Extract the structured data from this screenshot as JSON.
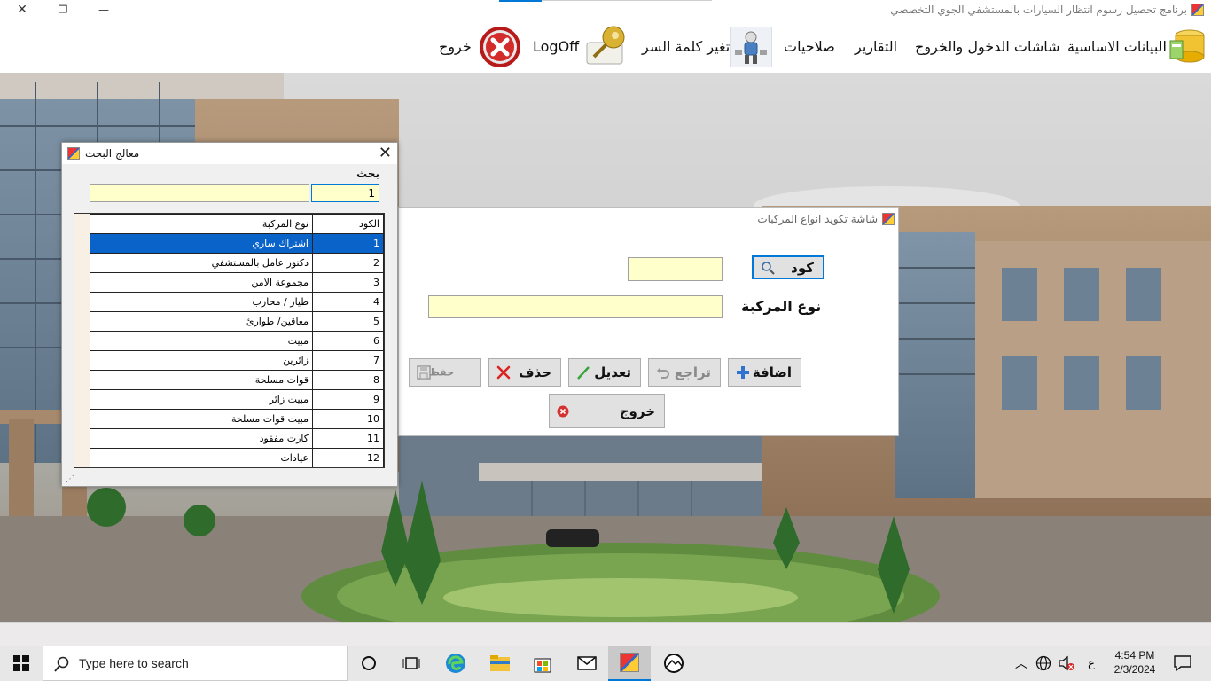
{
  "window": {
    "title": "برنامج تحصيل رسوم انتظار السيارات بالمستشفي الجوي التخصصي",
    "close_glyph": "✕",
    "restore_glyph": "❐",
    "minimize_glyph": "—"
  },
  "menu": {
    "items": [
      {
        "label": "البيانات الاساسية",
        "icon": "database-icon"
      },
      {
        "label": "شاشات الدخول والخروج"
      },
      {
        "label": "التقارير"
      },
      {
        "label": "صلاحيات",
        "icon": "permissions-person-icon"
      },
      {
        "label": "تغير كلمة السر",
        "icon": "key-icon"
      },
      {
        "label": "LogOff",
        "icon": "logoff-x-icon"
      },
      {
        "label": "خروج"
      }
    ]
  },
  "search_window": {
    "title": "معالج البحث",
    "close_glyph": "✕",
    "search_label": "بحث",
    "code_value": "1",
    "text_value": "",
    "grid": {
      "headers": [
        "الكود",
        "نوع المركبة"
      ],
      "selected_index": 0,
      "rows": [
        {
          "code": "1",
          "name": "اشتراك ساري"
        },
        {
          "code": "2",
          "name": "دكتور عامل بالمستشفي"
        },
        {
          "code": "3",
          "name": "مجموعة الامن"
        },
        {
          "code": "4",
          "name": "طيار / محارب"
        },
        {
          "code": "5",
          "name": "معاقين/ طوارئ"
        },
        {
          "code": "6",
          "name": "مبيت"
        },
        {
          "code": "7",
          "name": "زائرين"
        },
        {
          "code": "8",
          "name": "قوات مسلحة"
        },
        {
          "code": "9",
          "name": "مبيت زائر"
        },
        {
          "code": "10",
          "name": "مبيت قوات مسلحة"
        },
        {
          "code": "11",
          "name": "كارت مفقود"
        },
        {
          "code": "12",
          "name": "عيادات"
        }
      ]
    }
  },
  "coding_window": {
    "title": "شاشة تكويد انواع المركبات",
    "code_button_label": "كود",
    "code_value": "",
    "vehicle_type_label": "نوع المركبة",
    "vehicle_type_value": "",
    "buttons": {
      "add": "اضافة",
      "undo": "تراجع",
      "edit": "تعديل",
      "delete": "حذف",
      "save": "حفظ",
      "exit": "خروج"
    }
  },
  "taskbar": {
    "search_placeholder": "Type here to search",
    "ime_indicator": "ع",
    "time": "4:54 PM",
    "date": "2/3/2024"
  },
  "colors": {
    "input_bg": "#ffffcc",
    "selection": "#0a63c9",
    "accent": "#0078d7"
  }
}
